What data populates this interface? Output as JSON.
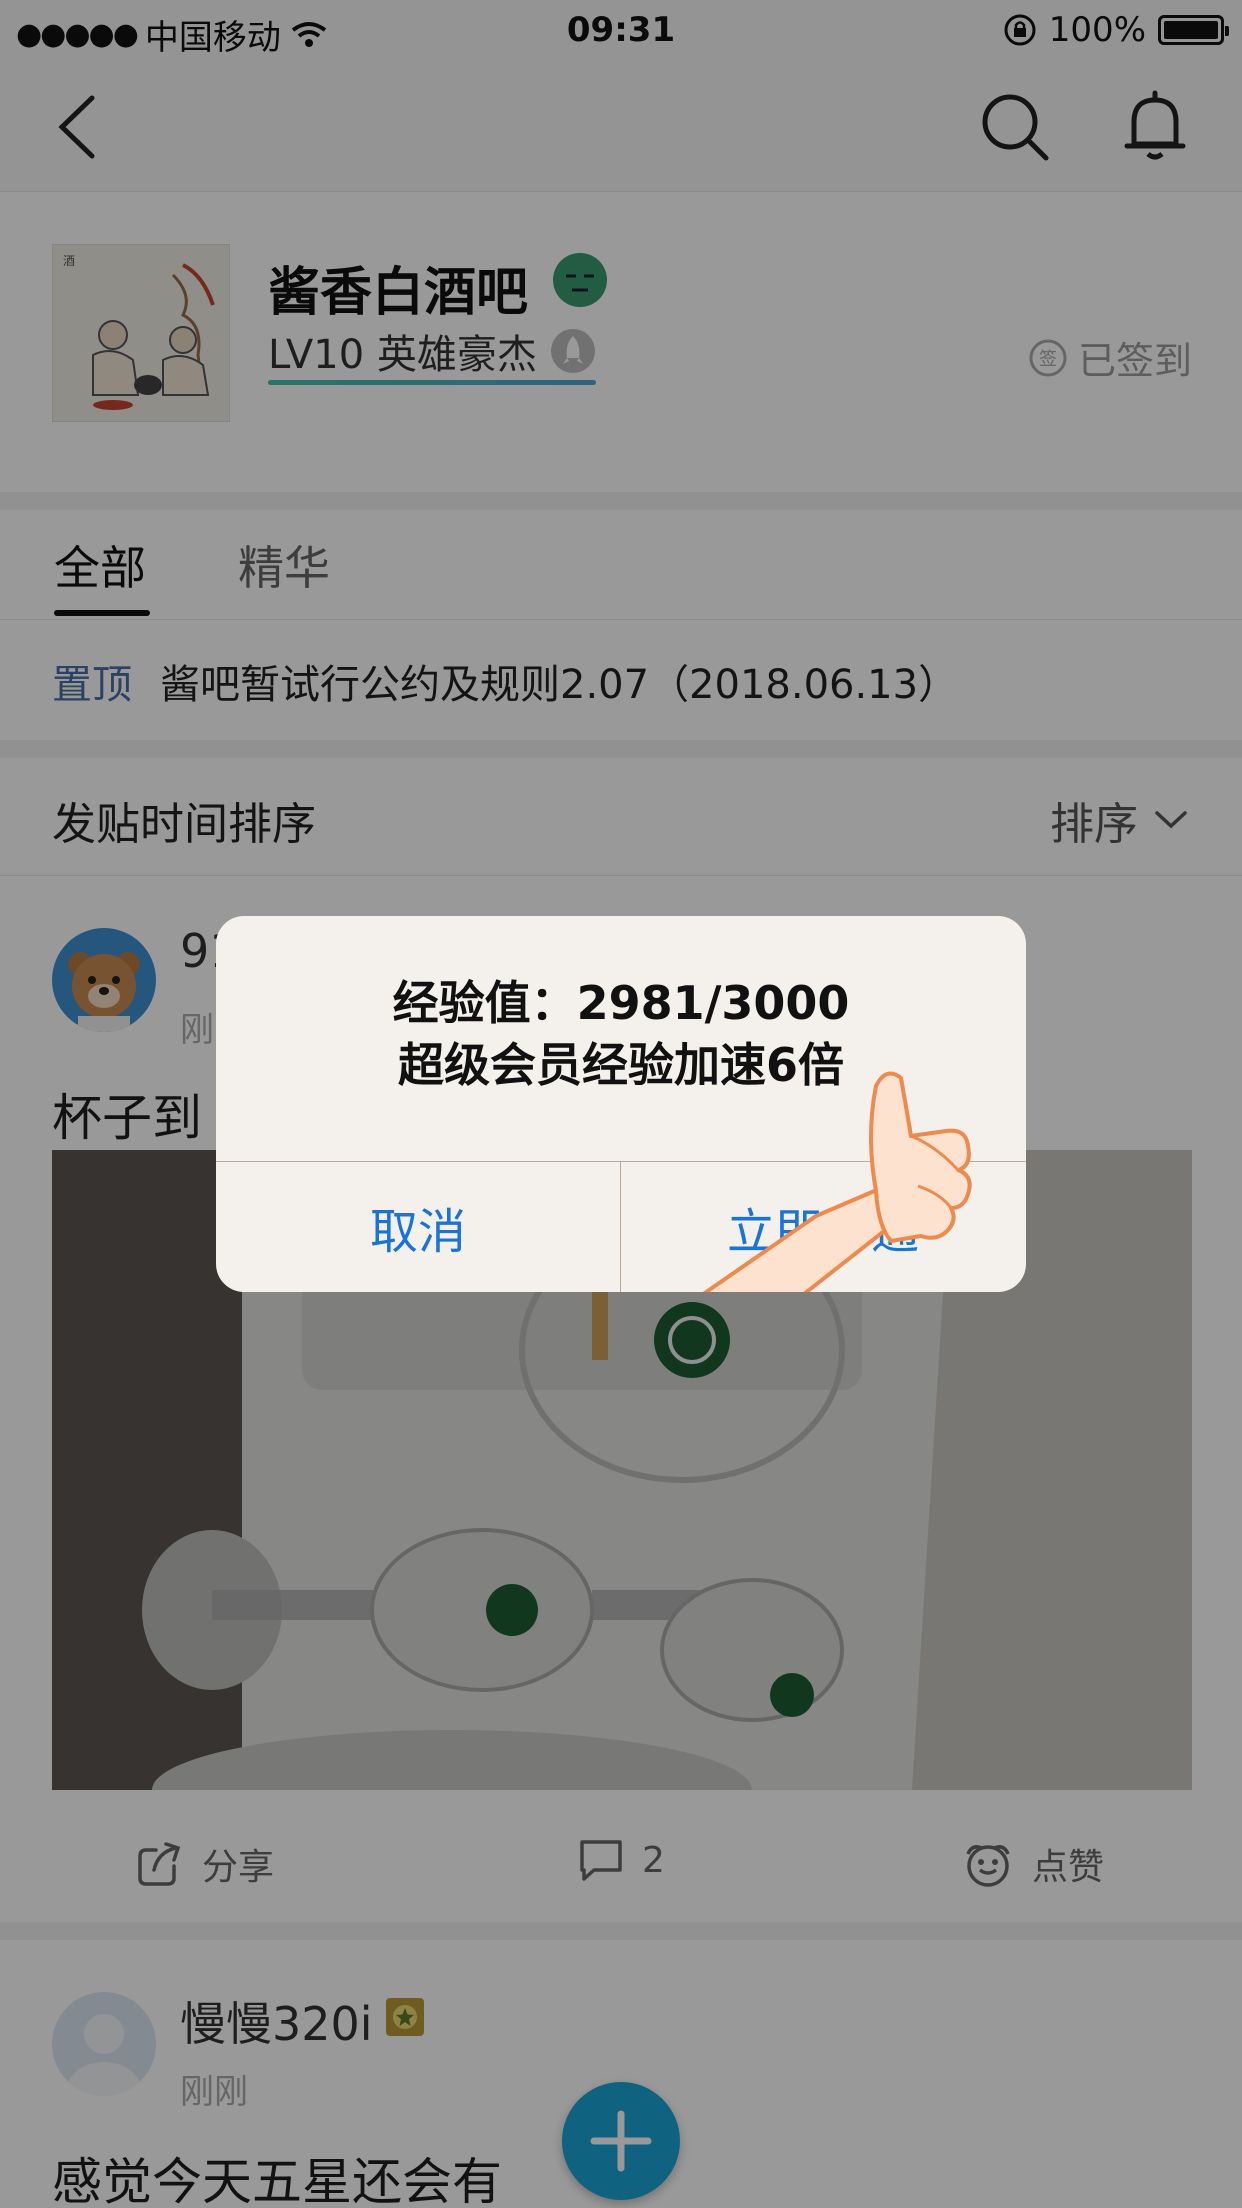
{
  "status_bar": {
    "signal_dots": "●●●●●",
    "carrier": "中国移动",
    "time": "09:31",
    "battery": "100%"
  },
  "nav": {
    "back_icon": "chevron-left-icon",
    "search_icon": "search-icon",
    "bell_icon": "bell-icon"
  },
  "forum": {
    "name": "酱香白酒吧",
    "level": "LV10 英雄豪杰",
    "sign_status": "已签到"
  },
  "tabs": [
    {
      "label": "全部",
      "active": true
    },
    {
      "label": "精华",
      "active": false
    }
  ],
  "pinned": {
    "tag": "置顶",
    "title": "酱吧暂试行公约及规则2.07（2018.06.13）"
  },
  "sort": {
    "label": "发贴时间排序",
    "button": "排序"
  },
  "posts": [
    {
      "username": "91",
      "time": "刚",
      "title": "杯子到",
      "actions": {
        "share": "分享",
        "comments": "2",
        "like": "点赞"
      }
    },
    {
      "username": "慢慢320i",
      "time": "刚刚",
      "title": "感觉今天五星还会有"
    }
  ],
  "dialog": {
    "line1": "经验值：2981/3000",
    "line2": "超级会员经验加速6倍",
    "cancel": "取消",
    "confirm": "立即开通"
  },
  "colors": {
    "accent_blue": "#1a73d9",
    "fab": "#1aa3d6",
    "pinned_tag": "#4a6fa5",
    "level_bar": "#3fc7a8"
  }
}
